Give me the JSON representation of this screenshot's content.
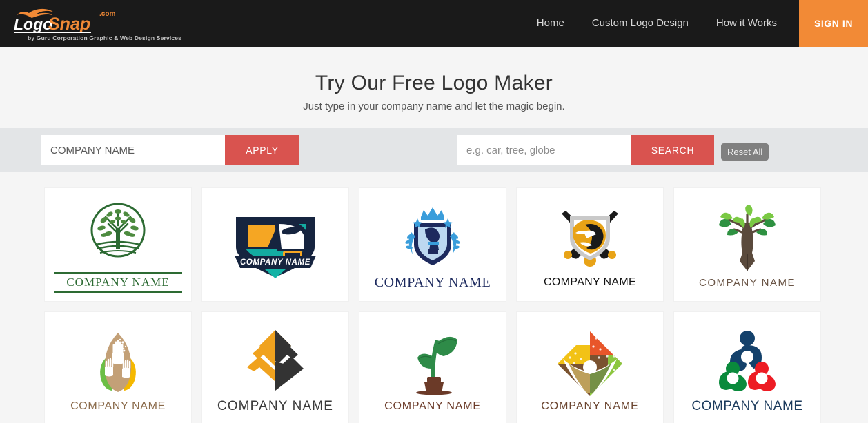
{
  "header": {
    "brand_name_part1": "Logo",
    "brand_name_part2": "Snap",
    "brand_tld": ".com",
    "tagline": "by Guru Corporation Graphic & Web Design Services",
    "nav": [
      {
        "label": "Home",
        "name": "nav-home"
      },
      {
        "label": "Custom Logo Design",
        "name": "nav-custom-logo-design"
      },
      {
        "label": "How it Works",
        "name": "nav-how-it-works"
      }
    ],
    "signin_label": "SIGN IN",
    "colors": {
      "background": "#1a1a1a",
      "accent": "#f28a36"
    }
  },
  "hero": {
    "title": "Try Our Free Logo Maker",
    "subtitle": "Just type in your company name and let the magic begin."
  },
  "searchbar": {
    "company_value": "COMPANY NAME",
    "company_placeholder": "COMPANY NAME",
    "apply_label": "APPLY",
    "keyword_value": "",
    "keyword_placeholder": "e.g. car, tree, globe",
    "search_label": "SEARCH",
    "reset_label": "Reset All",
    "colors": {
      "band": "#e3e5e7",
      "button": "#d9534f",
      "reset": "#808080"
    }
  },
  "results": {
    "cards": [
      {
        "name": "logo-card-tree-circle",
        "label": "COMPANY NAME",
        "icon": "tree-in-circle-icon",
        "colors": {
          "primary": "#2d6b33",
          "secondary": "#6aa84f"
        }
      },
      {
        "name": "logo-card-train-shield",
        "label": "COMPANY NAME",
        "icon": "train-shield-icon",
        "colors": {
          "primary": "#16243f",
          "secondary": "#f5a623",
          "tertiary": "#13b3a6"
        }
      },
      {
        "name": "logo-card-chess-knight-shield",
        "label": "COMPANY NAME",
        "icon": "chess-knight-crown-shield-icon",
        "colors": {
          "primary": "#1d2a5e",
          "secondary": "#3a9ddb"
        }
      },
      {
        "name": "logo-card-eagle-hockey",
        "label": "COMPANY NAME",
        "icon": "eagle-crossed-sticks-icon",
        "colors": {
          "primary": "#e8a317",
          "secondary": "#1a1a1a",
          "tertiary": "#b9b9b9"
        }
      },
      {
        "name": "logo-card-tree-pen",
        "label": "COMPANY NAME",
        "icon": "tree-pen-icon",
        "colors": {
          "primary": "#5a4a3c",
          "secondary": "#7ac943",
          "tertiary": "#2e9141"
        }
      },
      {
        "name": "logo-card-hands-leaves",
        "label": "COMPANY NAME",
        "icon": "three-hands-leaves-icon",
        "colors": {
          "primary": "#c3a077",
          "secondary": "#6cbe45",
          "tertiary": "#f5b800"
        }
      },
      {
        "name": "logo-card-pyramid-diamond",
        "label": "COMPANY NAME",
        "icon": "pyramid-diamond-icon",
        "colors": {
          "primary": "#f0a21e",
          "secondary": "#333333"
        }
      },
      {
        "name": "logo-card-sprout-pot",
        "label": "COMPANY NAME",
        "icon": "sprout-in-pot-icon",
        "colors": {
          "primary": "#2e8b48",
          "secondary": "#6b3a28"
        }
      },
      {
        "name": "logo-card-diamond-quadrants",
        "label": "COMPANY NAME",
        "icon": "four-quadrant-diamond-person-icon",
        "colors": {
          "primary": "#e8562a",
          "secondary": "#f2c216",
          "tertiary": "#8cc63e",
          "quaternary": "#7a5230"
        }
      },
      {
        "name": "logo-card-three-people",
        "label": "COMPANY NAME",
        "icon": "three-linked-people-icon",
        "colors": {
          "primary": "#14416b",
          "secondary": "#0a8a3c",
          "tertiary": "#ed1c24"
        }
      }
    ]
  }
}
